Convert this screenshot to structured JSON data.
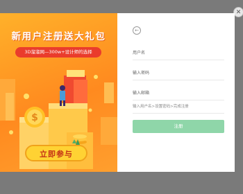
{
  "close_glyph": "✕",
  "promo": {
    "title": "新用户注册送大礼包",
    "subtitle": "3D溜溜网—300w+设计师的选择",
    "cta_label": "立即参与",
    "coin_glyph": "$"
  },
  "form": {
    "back_glyph": "←",
    "username_placeholder": "用户名",
    "password_placeholder": "输入密码",
    "email_placeholder": "输入邮箱",
    "steps_text": "输入用户名>设置密码>完成注册",
    "submit_label": "注册"
  },
  "colors": {
    "promo_bg": "#ff9f2e",
    "subtitle_bg": "#ea3c2c",
    "cta_bg": "#ffd233",
    "submit_bg": "#8fd6a9"
  }
}
